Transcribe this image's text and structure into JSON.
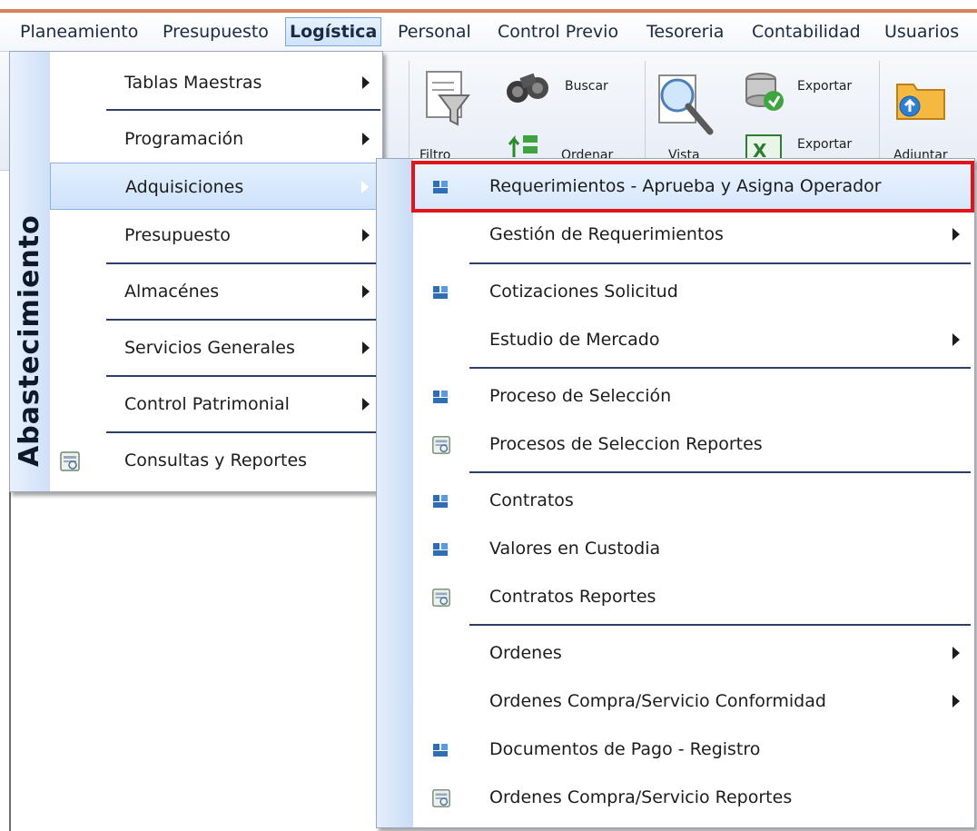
{
  "menubar": {
    "items": [
      {
        "label": "Planeamiento"
      },
      {
        "label": "Presupuesto"
      },
      {
        "label": "Logística"
      },
      {
        "label": "Personal"
      },
      {
        "label": "Control Previo"
      },
      {
        "label": "Tesoreria"
      },
      {
        "label": "Contabilidad"
      },
      {
        "label": "Usuarios"
      }
    ],
    "active_index": 2
  },
  "toolbar": {
    "buscar": "Buscar",
    "exportar_1": "Exportar",
    "exportar_2": "Exportar",
    "filtro": "Filtro",
    "ordenar": "Ordenar",
    "vista": "Vista",
    "adjuntar": "Adjuntar"
  },
  "dropdown": {
    "sidebar_title": "Abastecimiento",
    "items": [
      {
        "label": "Tablas Maestras",
        "has_submenu": true
      },
      {
        "label": "Programación",
        "has_submenu": true
      },
      {
        "label": "Adquisiciones",
        "has_submenu": true,
        "hover": true
      },
      {
        "label": "Presupuesto",
        "has_submenu": true
      },
      {
        "label": "Almacénes",
        "has_submenu": true
      },
      {
        "label": "Servicios Generales",
        "has_submenu": true
      },
      {
        "label": "Control Patrimonial",
        "has_submenu": true
      },
      {
        "label": "Consultas y Reportes",
        "has_submenu": false,
        "icon": "report-icon"
      }
    ]
  },
  "submenu": {
    "items": [
      {
        "label": "Requerimientos - Aprueba y Asigna Operador",
        "icon": "form-icon",
        "highlighted": true
      },
      {
        "label": "Gestión de Requerimientos",
        "has_submenu": true
      },
      {
        "label": "Cotizaciones Solicitud",
        "icon": "form-icon"
      },
      {
        "label": "Estudio de Mercado",
        "has_submenu": true
      },
      {
        "label": "Proceso de Selección",
        "icon": "form-icon"
      },
      {
        "label": "Procesos de Seleccion Reportes",
        "icon": "report-icon"
      },
      {
        "label": "Contratos",
        "icon": "form-icon"
      },
      {
        "label": "Valores en Custodia",
        "icon": "form-icon"
      },
      {
        "label": "Contratos Reportes",
        "icon": "report-icon"
      },
      {
        "label": "Ordenes",
        "has_submenu": true
      },
      {
        "label": "Ordenes Compra/Servicio Conformidad",
        "has_submenu": true
      },
      {
        "label": "Documentos de Pago - Registro",
        "icon": "form-icon"
      },
      {
        "label": "Ordenes Compra/Servicio Reportes",
        "icon": "report-icon"
      }
    ]
  },
  "colors": {
    "highlight_border": "#e0151c",
    "menu_separator": "#2d3f6a",
    "hover_fill": "#cde2fb",
    "top_accent": "#d9825b"
  }
}
